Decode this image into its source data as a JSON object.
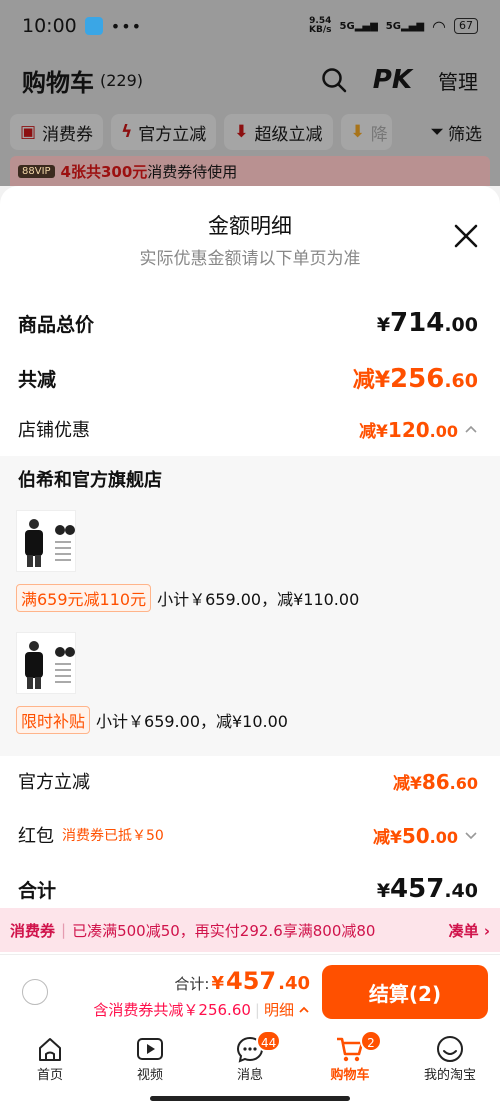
{
  "status_bar": {
    "time": "10:00",
    "dots": "•••",
    "net_speed_value": "9.54",
    "net_speed_unit": "KB/s",
    "signal1": "5G",
    "signal2": "5G",
    "battery": "67"
  },
  "header": {
    "title": "购物车",
    "count": "(229)",
    "pk_label": "PK",
    "manage_label": "管理"
  },
  "filters": [
    {
      "label": "消费券",
      "icon": "coupon-icon"
    },
    {
      "label": "官方立减",
      "icon": "bolt-icon"
    },
    {
      "label": "超级立减",
      "icon": "arrow-down-icon"
    },
    {
      "label": "降",
      "icon": "price-drop-icon"
    }
  ],
  "filter_button": {
    "label": "筛选"
  },
  "vip_banner": {
    "badge": "88VIP",
    "highlight": "4张共300元",
    "text": "消费券待使用"
  },
  "sheet": {
    "title": "金额明细",
    "subtitle": "实际优惠金额请以下单页为准",
    "goods_total": {
      "label": "商品总价",
      "currency": "¥",
      "integer": "714",
      "decimal": ".00"
    },
    "total_reduce": {
      "label": "共减",
      "prefix": "减¥",
      "integer": "256",
      "decimal": ".60"
    },
    "store_discount": {
      "label": "店铺优惠",
      "prefix": "减¥",
      "integer": "120",
      "decimal": ".00"
    },
    "store": {
      "name": "伯希和官方旗舰店",
      "items": [
        {
          "tag": "满659元减110元",
          "summary": "小计￥659.00，减¥110.00"
        },
        {
          "tag": "限时补贴",
          "summary": "小计￥659.00，减¥10.00"
        }
      ]
    },
    "official_reduce": {
      "label": "官方立减",
      "prefix": "减¥",
      "integer": "86",
      "decimal": ".60"
    },
    "hongbao": {
      "label": "红包",
      "note": "消费券已抵￥50",
      "prefix": "减¥",
      "integer": "50",
      "decimal": ".00"
    },
    "sum": {
      "label": "合计",
      "currency": "¥",
      "integer": "457",
      "decimal": ".40"
    }
  },
  "coupon_bar": {
    "tag": "消费券",
    "text": "已凑满500减50，再实付292.6享满800减80",
    "action": "凑单"
  },
  "checkout": {
    "total_label": "合计:",
    "currency": "¥",
    "integer": "457",
    "decimal": ".40",
    "discount_text": "含消费券共减￥256.60",
    "detail_label": "明细",
    "pay_label": "结算(2)"
  },
  "tabbar": [
    {
      "label": "首页",
      "icon": "home-icon",
      "badge": ""
    },
    {
      "label": "视频",
      "icon": "video-icon",
      "badge": ""
    },
    {
      "label": "消息",
      "icon": "message-icon",
      "badge": "44"
    },
    {
      "label": "购物车",
      "icon": "cart-icon",
      "badge": "2"
    },
    {
      "label": "我的淘宝",
      "icon": "profile-icon",
      "badge": ""
    }
  ],
  "colors": {
    "accent": "#ff5000",
    "coupon_red": "#d0134b",
    "overlay": "#9a9a9a"
  }
}
